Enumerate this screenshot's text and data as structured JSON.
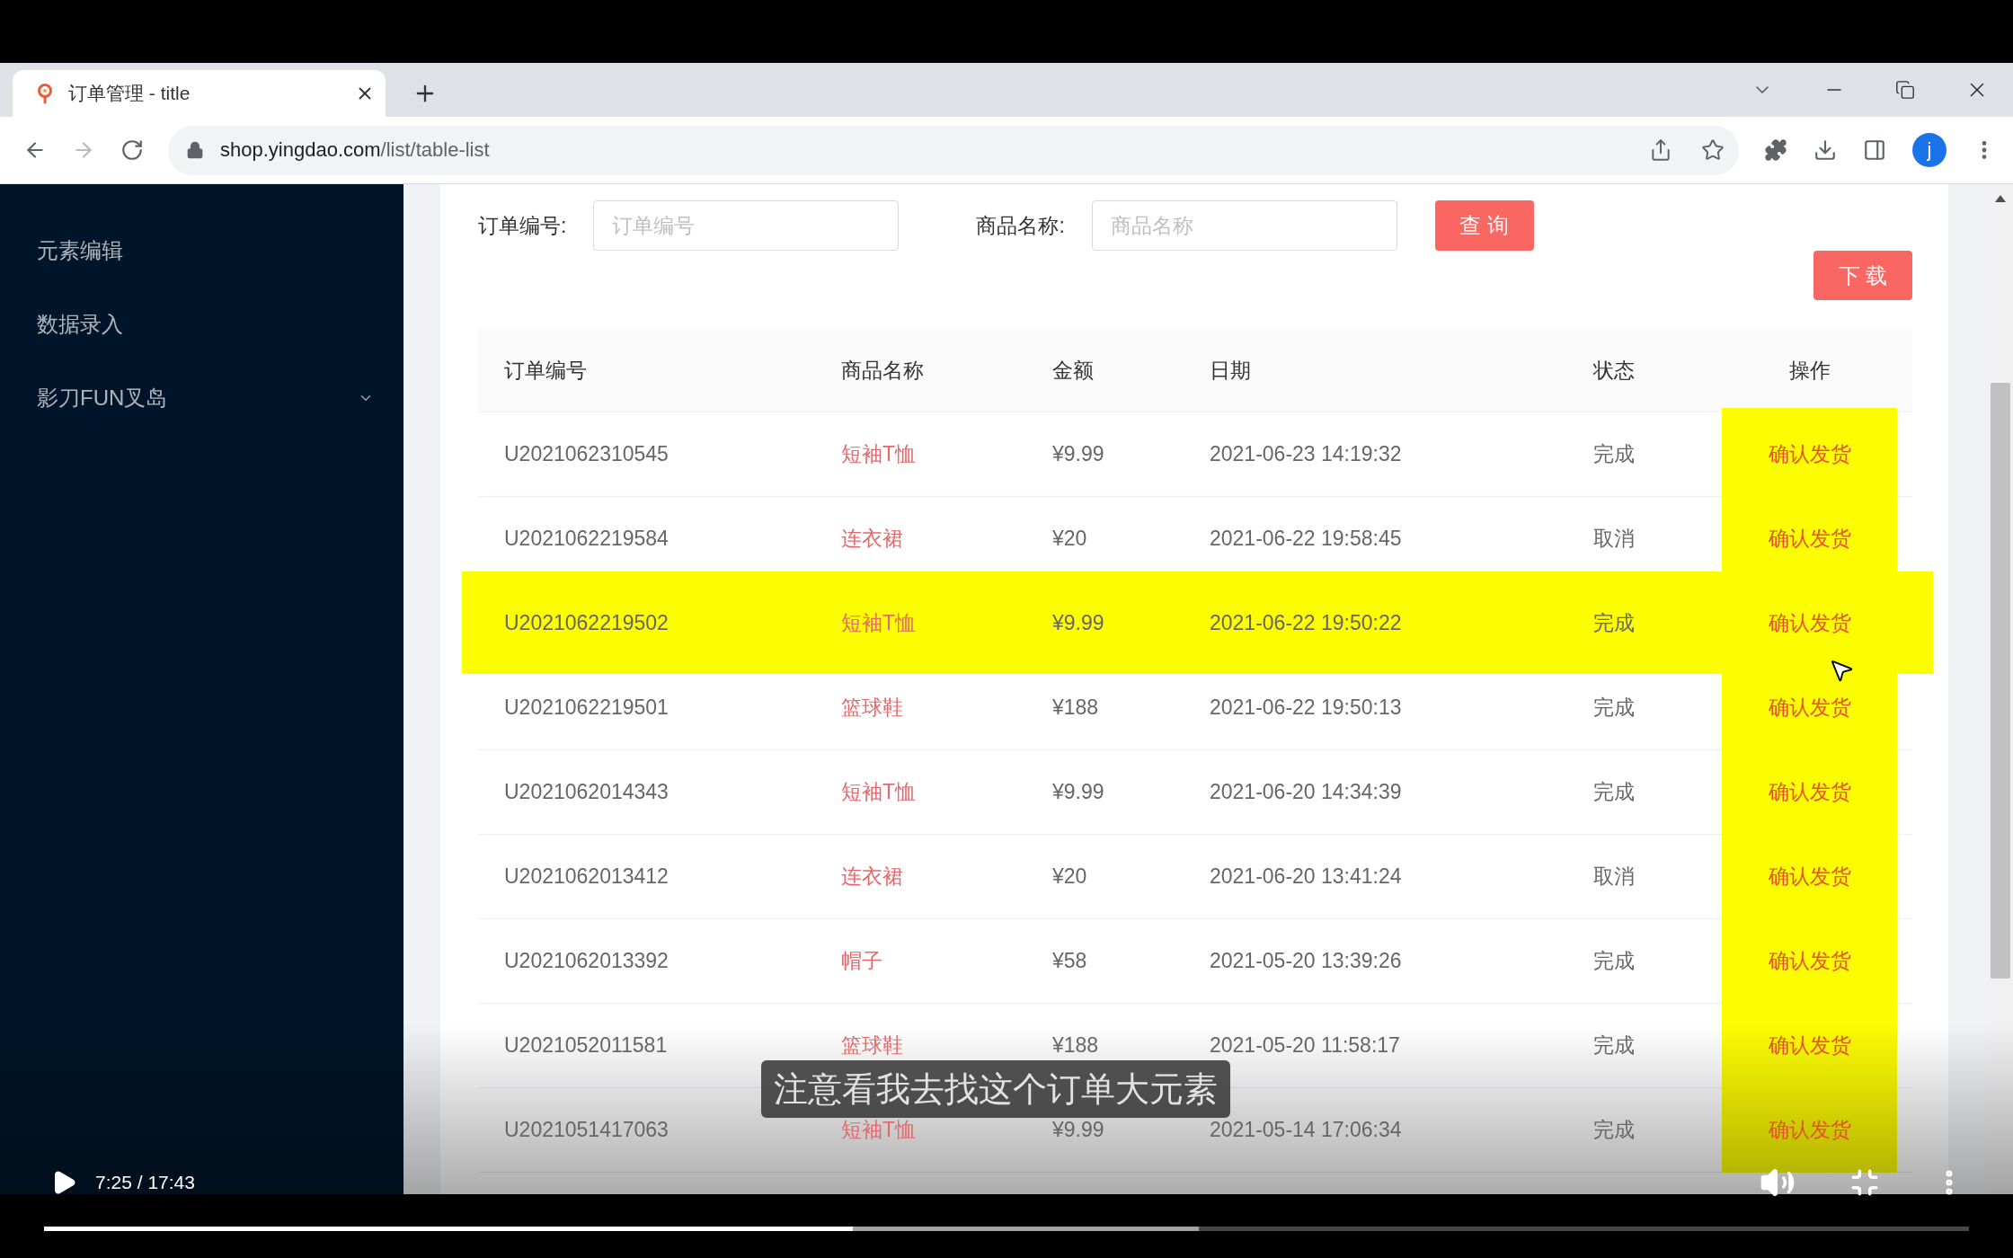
{
  "browser": {
    "tabs": [
      {
        "title": "订单管理 - title",
        "selected": true
      }
    ],
    "url": {
      "host": "shop.yingdao.com",
      "path": "/list/table-list"
    },
    "profile": {
      "initial": "j"
    }
  },
  "sidebar": {
    "items": [
      {
        "label": "元素编辑",
        "kind": "link"
      },
      {
        "label": "数据录入",
        "kind": "link"
      },
      {
        "label": "影刀FUN叉岛",
        "kind": "submenu"
      }
    ]
  },
  "filters": {
    "fields": [
      {
        "label": "订单编号:",
        "placeholder": "订单编号"
      },
      {
        "label": "商品名称:",
        "placeholder": "商品名称"
      }
    ],
    "query_button": "查 询",
    "download_button": "下 载"
  },
  "table": {
    "columns": [
      {
        "label": "订单编号",
        "highlighted": false
      },
      {
        "label": "商品名称",
        "highlighted": false
      },
      {
        "label": "金额",
        "highlighted": false
      },
      {
        "label": "日期",
        "highlighted": false
      },
      {
        "label": "状态",
        "highlighted": false
      },
      {
        "label": "操作",
        "highlighted": true
      }
    ],
    "rows": [
      {
        "order_no": "U2021062310545",
        "product": "短袖T恤",
        "amount": "¥9.99",
        "date": "2021-06-23 14:19:32",
        "status": "完成",
        "action": "确认发货",
        "highlighted": false
      },
      {
        "order_no": "U2021062219584",
        "product": "连衣裙",
        "amount": "¥20",
        "date": "2021-06-22 19:58:45",
        "status": "取消",
        "action": "确认发货",
        "highlighted": false
      },
      {
        "order_no": "U2021062219502",
        "product": "短袖T恤",
        "amount": "¥9.99",
        "date": "2021-06-22 19:50:22",
        "status": "完成",
        "action": "确认发货",
        "highlighted": true
      },
      {
        "order_no": "U2021062219501",
        "product": "篮球鞋",
        "amount": "¥188",
        "date": "2021-06-22 19:50:13",
        "status": "完成",
        "action": "确认发货",
        "highlighted": false
      },
      {
        "order_no": "U2021062014343",
        "product": "短袖T恤",
        "amount": "¥9.99",
        "date": "2021-06-20 14:34:39",
        "status": "完成",
        "action": "确认发货",
        "highlighted": false
      },
      {
        "order_no": "U2021062013412",
        "product": "连衣裙",
        "amount": "¥20",
        "date": "2021-06-20 13:41:24",
        "status": "取消",
        "action": "确认发货",
        "highlighted": false
      },
      {
        "order_no": "U2021062013392",
        "product": "帽子",
        "amount": "¥58",
        "date": "2021-05-20 13:39:26",
        "status": "完成",
        "action": "确认发货",
        "highlighted": false
      },
      {
        "order_no": "U2021052011581",
        "product": "篮球鞋",
        "amount": "¥188",
        "date": "2021-05-20 11:58:17",
        "status": "完成",
        "action": "确认发货",
        "highlighted": false
      },
      {
        "order_no": "U2021051417063",
        "product": "短袖T恤",
        "amount": "¥9.99",
        "date": "2021-05-14 17:06:34",
        "status": "完成",
        "action": "确认发货",
        "highlighted": false
      }
    ]
  },
  "video": {
    "subtitle": "注意看我去找这个订单大元素",
    "playing": false,
    "time": "7:25 / 17:43",
    "progress": {
      "level": 0.42
    },
    "buffer": {
      "level": 0.6
    }
  }
}
